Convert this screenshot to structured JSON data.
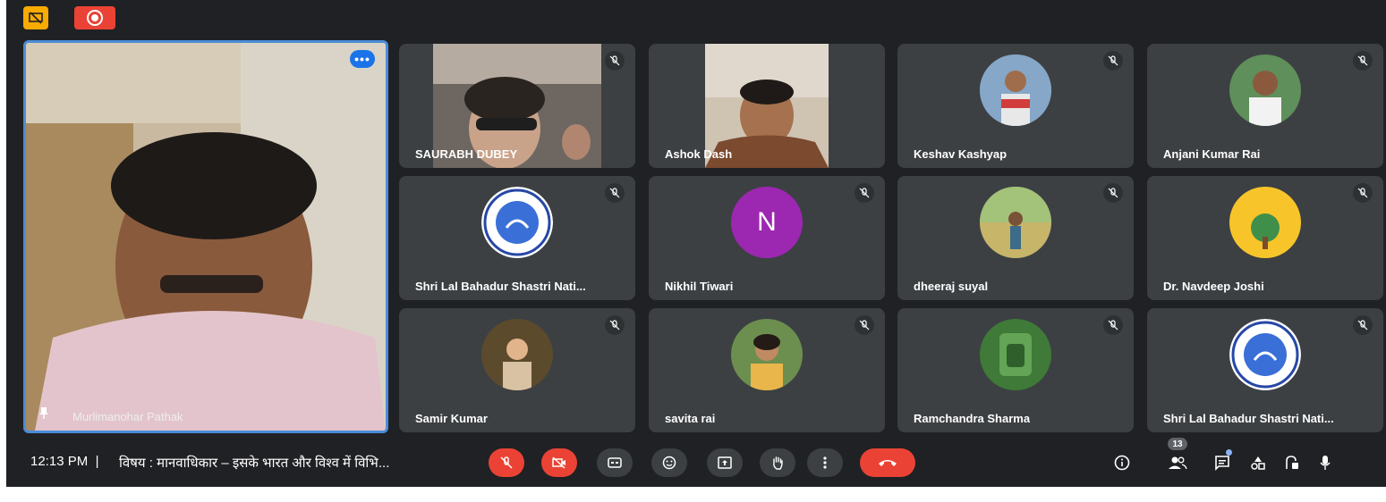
{
  "colors": {
    "background": "#202124",
    "tile": "#3c4043",
    "accent": "#1a73e8",
    "danger": "#ea4335",
    "warning": "#f9ab00"
  },
  "top_icons": [
    "no-presentation-icon",
    "recording-icon"
  ],
  "main_speaker": {
    "name": "Murlimanohar Pathak",
    "more_label": "•••"
  },
  "tiles": [
    {
      "name": "SAURABH DUBEY",
      "kind": "video",
      "muted": true
    },
    {
      "name": "Ashok Dash",
      "kind": "video",
      "muted": false
    },
    {
      "name": "Keshav Kashyap",
      "kind": "photo",
      "muted": true
    },
    {
      "name": "Anjani Kumar Rai",
      "kind": "photo",
      "muted": true
    },
    {
      "name": "Shri Lal Bahadur Shastri Nati...",
      "kind": "logo",
      "muted": true
    },
    {
      "name": "Nikhil Tiwari",
      "kind": "letter",
      "letter": "N",
      "muted": true
    },
    {
      "name": "dheeraj suyal",
      "kind": "photo",
      "muted": true
    },
    {
      "name": "Dr. Navdeep Joshi",
      "kind": "photo",
      "muted": true
    },
    {
      "name": "Samir Kumar",
      "kind": "photo",
      "muted": true
    },
    {
      "name": "savita rai",
      "kind": "photo",
      "muted": true
    },
    {
      "name": "Ramchandra Sharma",
      "kind": "photo",
      "muted": true
    },
    {
      "name": "Shri Lal Bahadur Shastri Nati...",
      "kind": "logo",
      "muted": true
    }
  ],
  "bottom_bar": {
    "time": "12:13 PM",
    "separator": "|",
    "meeting_title": "विषय : मानवाधिकार – इसके भारत और विश्व में विभि...",
    "controls": [
      "mic-off-icon",
      "camera-off-icon",
      "captions-icon",
      "emoji-icon",
      "present-icon",
      "raise-hand-icon",
      "more-options-icon",
      "hang-up-icon"
    ],
    "right_icons": [
      "info-icon",
      "people-icon",
      "chat-icon",
      "activities-icon",
      "host-controls-icon",
      "mic-status-icon"
    ],
    "people_count": "13"
  }
}
